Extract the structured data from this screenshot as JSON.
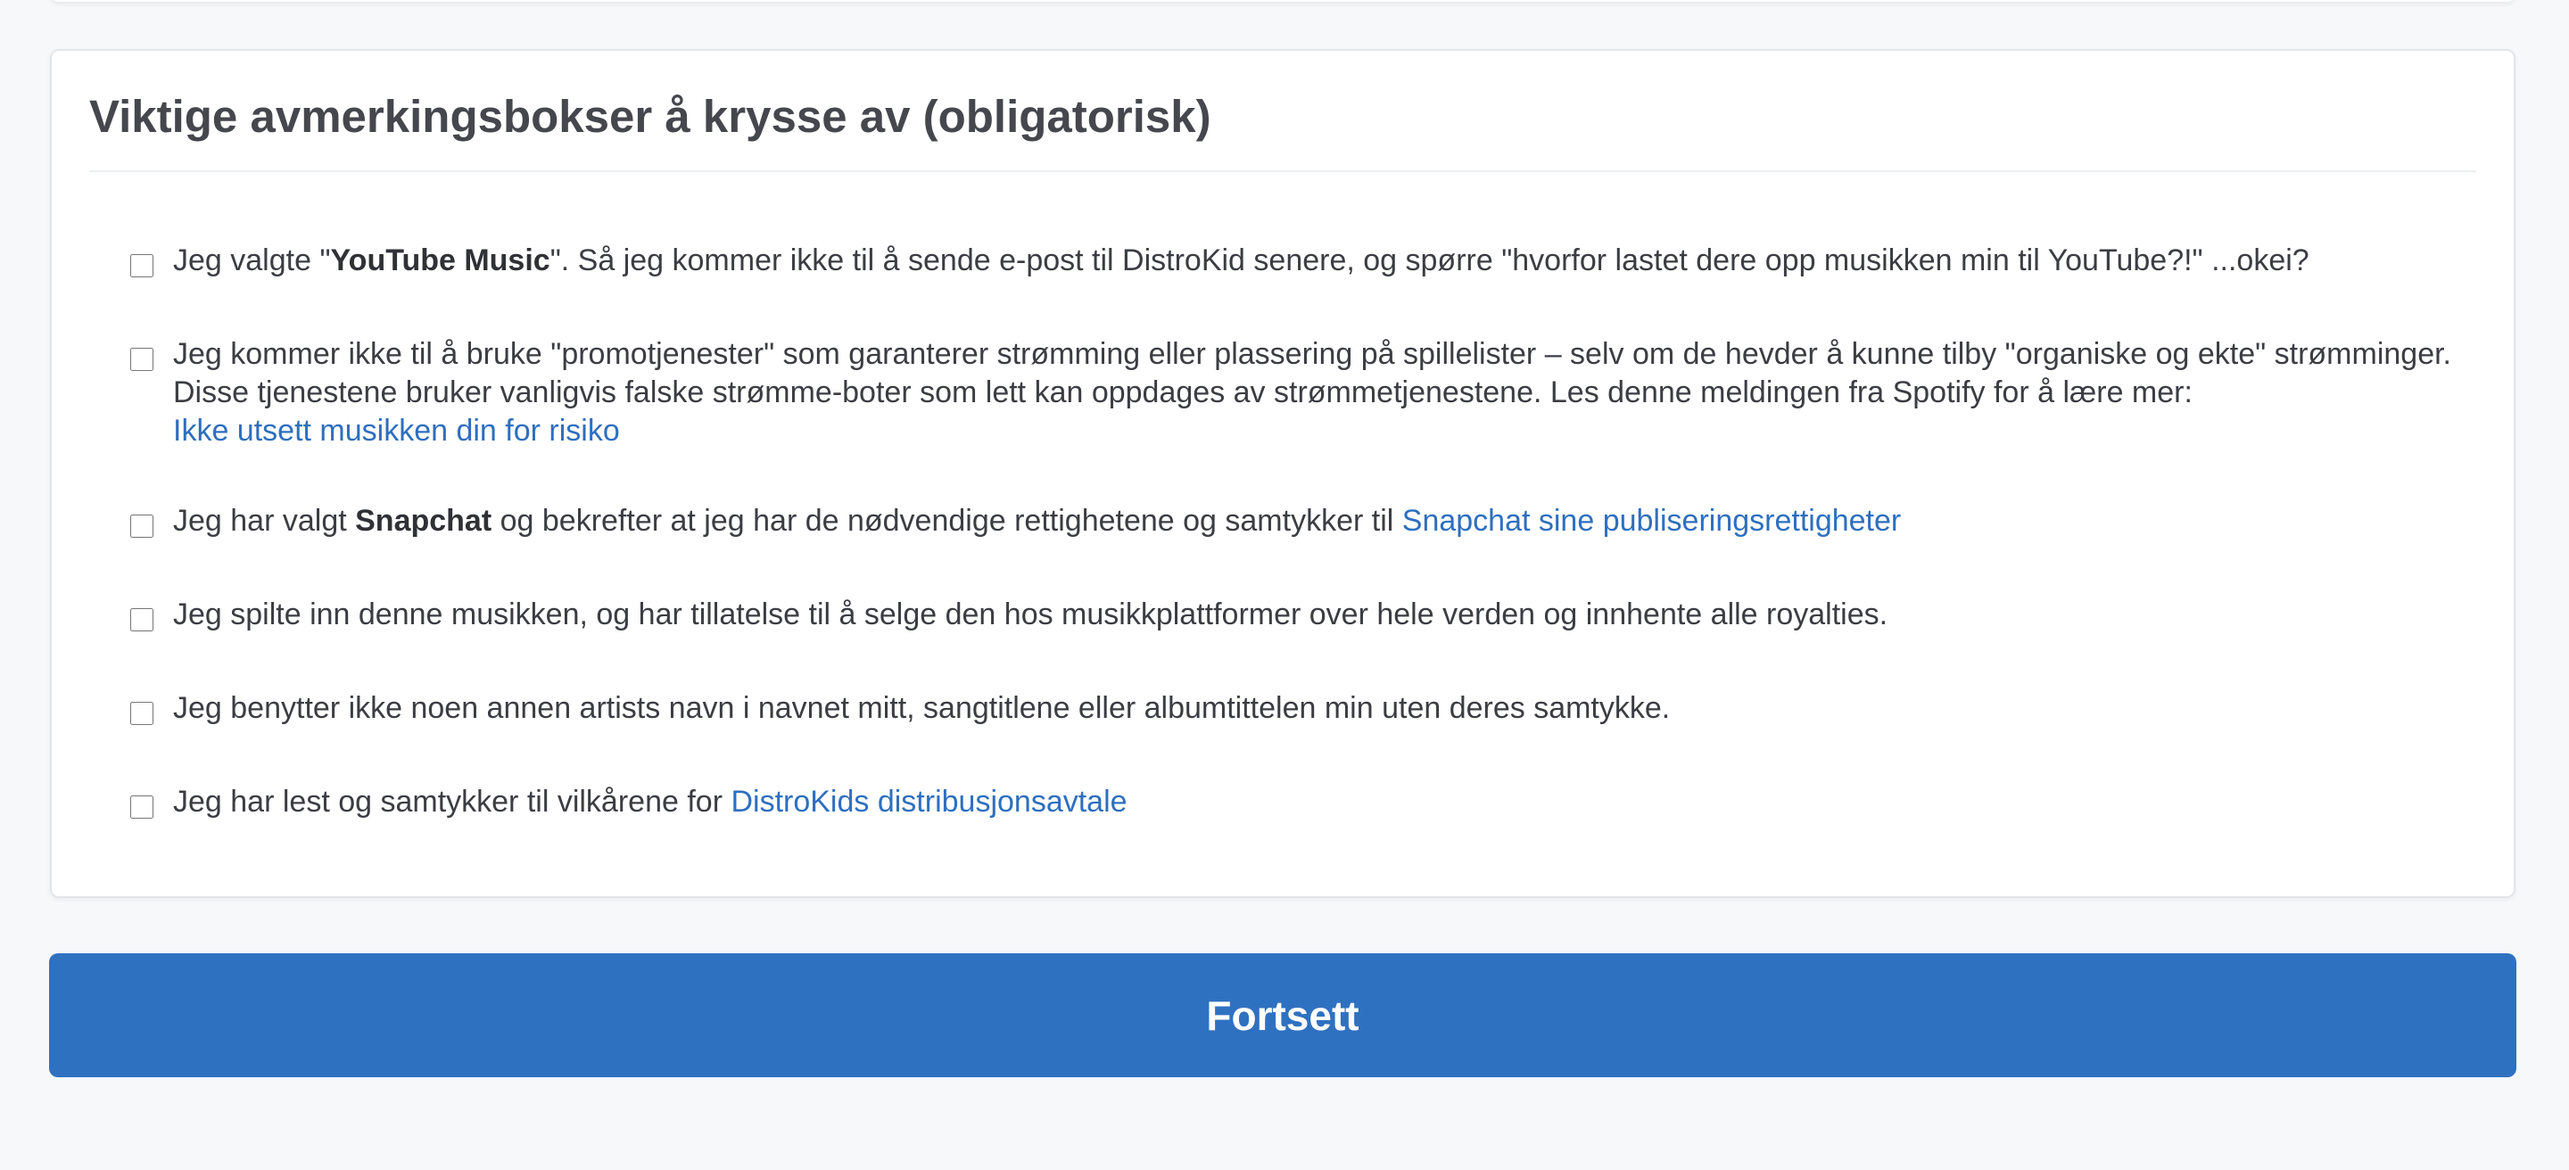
{
  "card": {
    "title": "Viktige avmerkingsbokser å krysse av (obligatorisk)"
  },
  "items": [
    {
      "pre": "Jeg valgte \"",
      "bold": "YouTube Music",
      "post": "\". Så jeg kommer ikke til å sende e-post til DistroKid senere, og spørre \"hvorfor lastet dere opp musikken min til YouTube?!\" ...okei?",
      "checked": false
    },
    {
      "text": "Jeg kommer ikke til å bruke \"promotjenester\" som garanterer strømming eller plassering på spillelister – selv om de hevder å kunne tilby \"organiske og ekte\" strømminger. Disse tjenestene bruker vanligvis falske strømme-boter som lett kan oppdages av strømmetjenestene. Les denne meldingen fra Spotify for å lære mer:",
      "link": "Ikke utsett musikken din for risiko",
      "checked": false
    },
    {
      "pre": "Jeg har valgt ",
      "bold": "Snapchat",
      "mid": " og bekrefter at jeg har de nødvendige rettighetene og samtykker til ",
      "link": "Snapchat sine publiseringsrettigheter",
      "checked": false
    },
    {
      "text": "Jeg spilte inn denne musikken, og har tillatelse til å selge den hos musikkplattformer over hele verden og innhente alle royalties.",
      "checked": false
    },
    {
      "text": "Jeg benytter ikke noen annen artists navn i navnet mitt, sangtitlene eller albumtittelen min uten deres samtykke.",
      "checked": false
    },
    {
      "pre": "Jeg har lest og samtykker til vilkårene for ",
      "link": "DistroKids distribusjonsavtale",
      "checked": false
    }
  ],
  "submit": {
    "label": "Fortsett"
  },
  "colors": {
    "accent": "#2f71c1",
    "link": "#2e6fbf",
    "page_background": "#f7f8fa"
  }
}
